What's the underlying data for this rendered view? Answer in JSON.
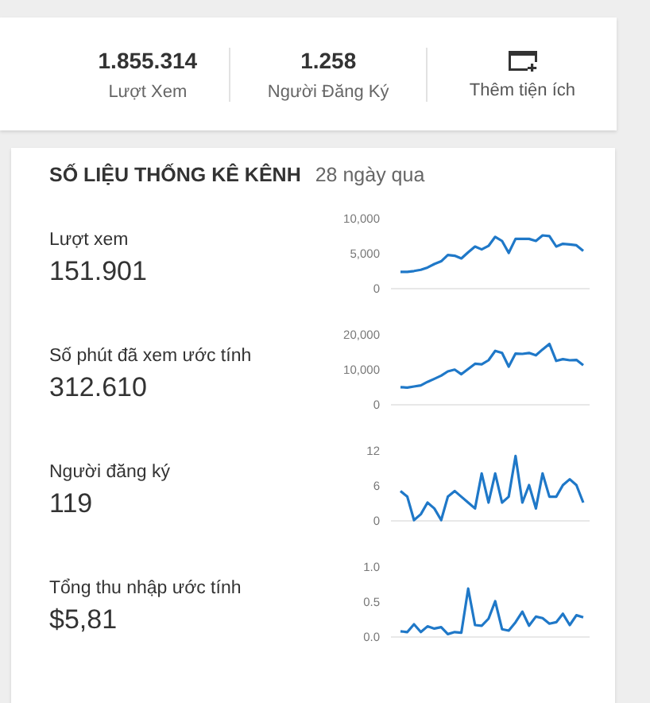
{
  "summary": {
    "stats": [
      {
        "value": "1.855.314",
        "label": "Lượt Xem"
      },
      {
        "value": "1.258",
        "label": "Người Đăng Ký"
      }
    ],
    "action": {
      "label": "Thêm tiện ích"
    }
  },
  "analytics": {
    "title": "SỐ LIỆU THỐNG KÊ KÊNH",
    "period": "28 ngày qua",
    "metrics": [
      {
        "label": "Lượt xem",
        "value": "151.901",
        "chart_data": {
          "type": "line",
          "ylim": [
            0,
            10000
          ],
          "yticks": [
            {
              "value": 0,
              "label": "0"
            },
            {
              "value": 5000,
              "label": "5,000"
            },
            {
              "value": 10000,
              "label": "10,000"
            }
          ],
          "series": [
            {
              "color": "#1f78c8",
              "values": [
                2300,
                2300,
                2400,
                2600,
                2900,
                3400,
                3800,
                4700,
                4600,
                4200,
                5100,
                5900,
                5500,
                6000,
                7300,
                6700,
                5000,
                7000,
                7000,
                7000,
                6700,
                7500,
                7400,
                5900,
                6300,
                6200,
                6100,
                5300
              ]
            }
          ]
        }
      },
      {
        "label": "Số phút đã xem ước tính",
        "value": "312.610",
        "chart_data": {
          "type": "line",
          "ylim": [
            0,
            20000
          ],
          "yticks": [
            {
              "value": 0,
              "label": "0"
            },
            {
              "value": 10000,
              "label": "10,000"
            },
            {
              "value": 20000,
              "label": "20,000"
            }
          ],
          "series": [
            {
              "color": "#1f78c8",
              "values": [
                4800,
                4700,
                5000,
                5300,
                6300,
                7200,
                8100,
                9300,
                9800,
                8500,
                10000,
                11500,
                11300,
                12500,
                15200,
                14600,
                10700,
                14400,
                14300,
                14600,
                13900,
                15600,
                17200,
                12300,
                12800,
                12500,
                12600,
                11100
              ]
            }
          ]
        }
      },
      {
        "label": "Người đăng ký",
        "value": "119",
        "chart_data": {
          "type": "line",
          "ylim": [
            0,
            12
          ],
          "yticks": [
            0,
            6,
            12
          ],
          "series": [
            {
              "color": "#1f78c8",
              "values": [
                5,
                4,
                0,
                1,
                3,
                2,
                0,
                4,
                5,
                4,
                3,
                2,
                8,
                3,
                8,
                3,
                4,
                11,
                3,
                6,
                2,
                8,
                4,
                4,
                6,
                7,
                6,
                3
              ]
            }
          ]
        }
      },
      {
        "label": "Tổng thu nhập ước tính",
        "value": "$5,81",
        "chart_data": {
          "type": "line",
          "ylim": [
            0,
            1
          ],
          "yticks": [
            {
              "value": 0,
              "label": "0.0"
            },
            {
              "value": 0.5,
              "label": "0.5"
            },
            {
              "value": 1,
              "label": "1.0"
            }
          ],
          "series": [
            {
              "color": "#1f78c8",
              "values": [
                0.07,
                0.06,
                0.17,
                0.06,
                0.14,
                0.11,
                0.13,
                0.03,
                0.06,
                0.05,
                0.68,
                0.16,
                0.15,
                0.25,
                0.5,
                0.1,
                0.08,
                0.2,
                0.35,
                0.15,
                0.28,
                0.26,
                0.18,
                0.2,
                0.32,
                0.16,
                0.3,
                0.27
              ]
            }
          ]
        }
      }
    ]
  }
}
